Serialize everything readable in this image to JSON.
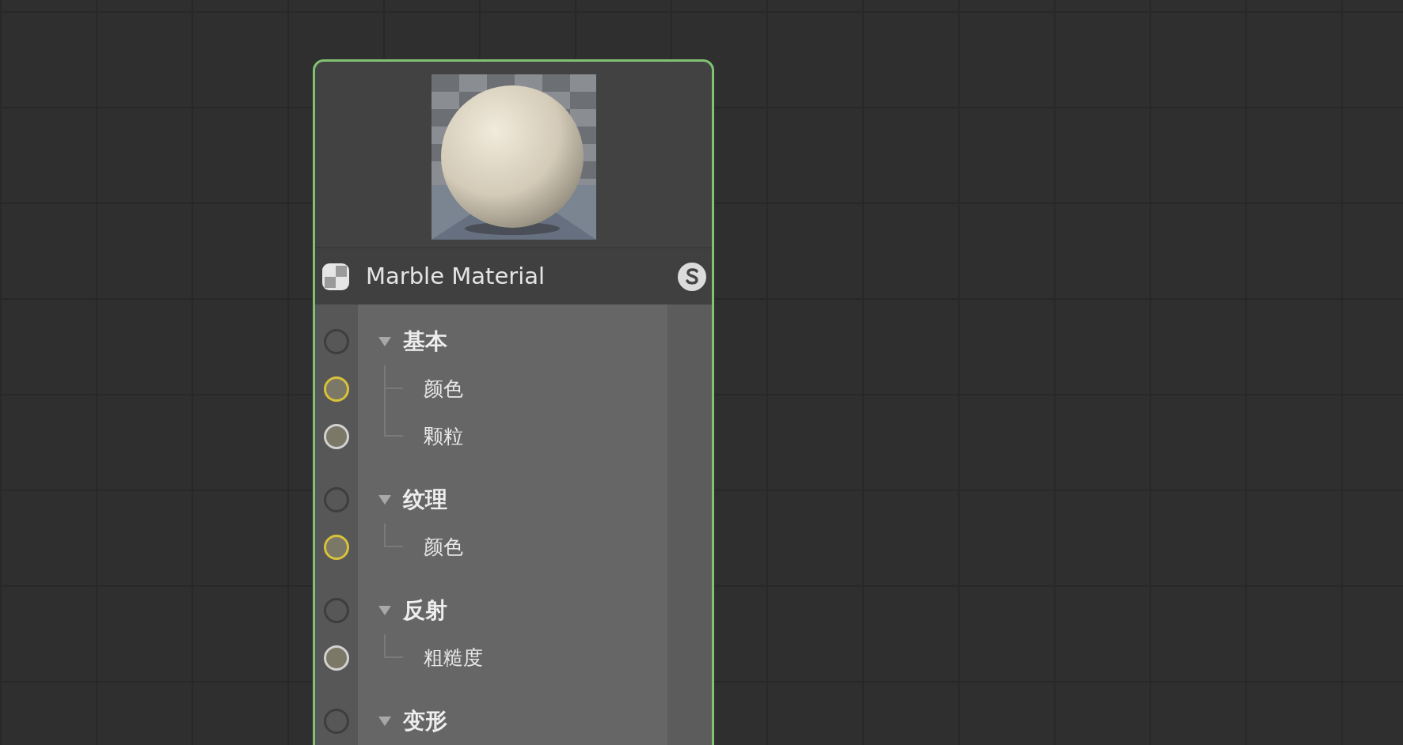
{
  "node": {
    "title": "Marble Material",
    "selected": true,
    "groups": [
      {
        "label": "基本",
        "expanded": true,
        "color": "#3e3e3e",
        "children": [
          {
            "label": "颜色",
            "color": "#d9c23a"
          },
          {
            "label": "颗粒",
            "color": "#d2d2d2"
          }
        ]
      },
      {
        "label": "纹理",
        "expanded": true,
        "color": "#3e3e3e",
        "children": [
          {
            "label": "颜色",
            "color": "#d9c23a"
          }
        ]
      },
      {
        "label": "反射",
        "expanded": true,
        "color": "#3e3e3e",
        "children": [
          {
            "label": "粗糙度",
            "color": "#d2d2d2"
          }
        ]
      },
      {
        "label": "变形",
        "expanded": true,
        "color": "#3e3e3e"
      }
    ]
  }
}
